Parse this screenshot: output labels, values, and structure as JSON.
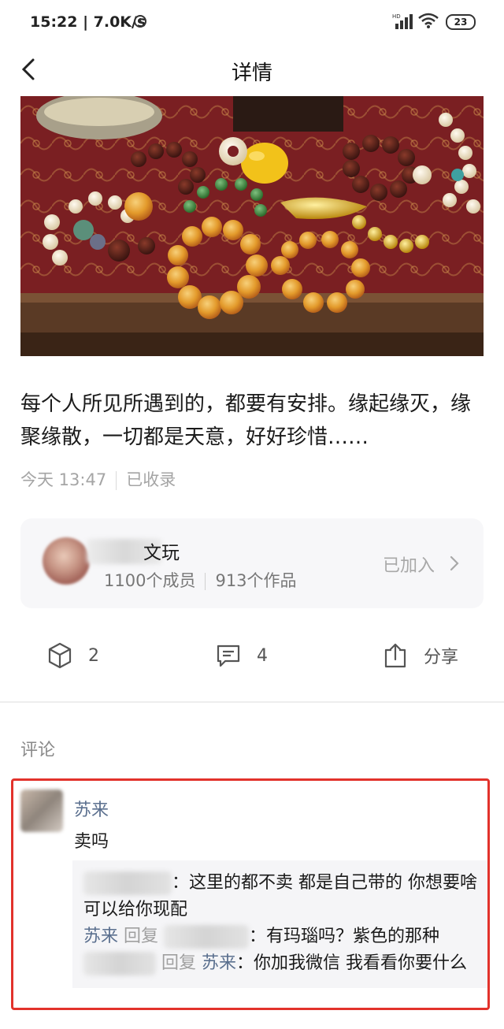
{
  "status_bar": {
    "time": "15:22 | 7.0K/s",
    "battery": "23",
    "icons": [
      "alarm-clock-icon",
      "hd-signal-icon",
      "wifi-icon",
      "battery-icon"
    ]
  },
  "header": {
    "title": "详情",
    "back_icon": "chevron-left-icon"
  },
  "post": {
    "text": "每个人所见所遇到的，都要有安排。缘起缘灭，缘聚缘散，一切都是天意，好好珍惜……",
    "time": "今天 13:47",
    "status": "已收录"
  },
  "group": {
    "name": "文玩",
    "members": "1100个成员",
    "works": "913个作品",
    "joined": "已加入"
  },
  "actions": {
    "like_count": "2",
    "comment_count": "4",
    "share_label": "分享"
  },
  "comments_label": "评论",
  "comment": {
    "author": "苏来",
    "body": "卖吗",
    "replies": {
      "r1_text": "：这里的都不卖 都是自己带的 你想要啥可以给你现配",
      "r2_author": "苏来",
      "r2_reply_word": "回复",
      "r2_text": "：有玛瑙吗？紫色的那种",
      "r3_reply_word": "回复",
      "r3_target": "苏来",
      "r3_text": "：你加我微信 我看看你要什么"
    }
  },
  "colors": {
    "link": "#5a6f8e",
    "highlight": "#e2322b",
    "card_bg": "#f7f7f9"
  }
}
